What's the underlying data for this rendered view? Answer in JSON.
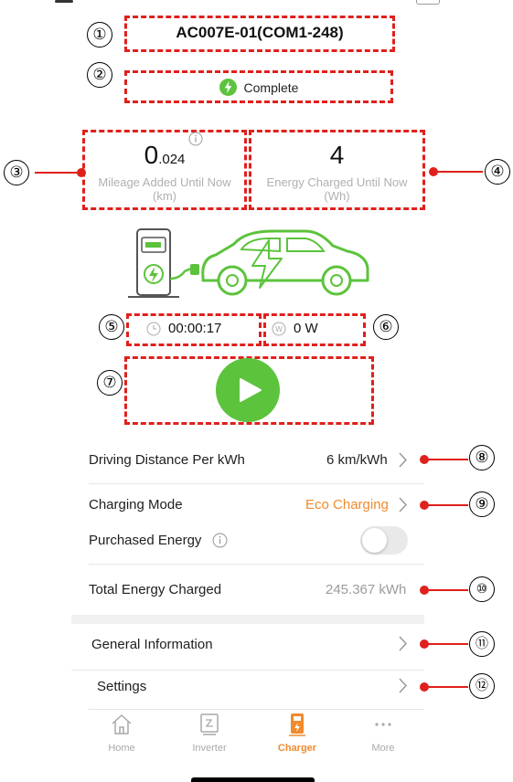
{
  "charger": {
    "name": "AC007E-01(COM1-248)",
    "status": "Complete",
    "mileage": {
      "value_main": "0",
      "value_sub": ".024",
      "label": "Mileage Added Until Now",
      "unit": "(km)"
    },
    "energy": {
      "value": "4",
      "label": "Energy Charged Until Now",
      "unit": "(Wh)"
    },
    "elapsed_time": "00:00:17",
    "power": "0 W"
  },
  "settings": {
    "driving_distance": {
      "label": "Driving Distance Per kWh",
      "value": "6 km/kWh"
    },
    "charging_mode": {
      "label": "Charging Mode",
      "value": "Eco Charging"
    },
    "purchased_energy": {
      "label": "Purchased Energy",
      "enabled": false
    },
    "total_energy": {
      "label": "Total Energy Charged",
      "value": "245.367 kWh"
    },
    "general_information": {
      "label": "General Information"
    },
    "settings_item": {
      "label": "Settings"
    }
  },
  "callouts": [
    "①",
    "②",
    "③",
    "④",
    "⑤",
    "⑥",
    "⑦",
    "⑧",
    "⑨",
    "⑩",
    "⑪",
    "⑫"
  ],
  "tabs": [
    {
      "label": "Home",
      "icon": "home-icon",
      "active": false
    },
    {
      "label": "Inverter",
      "icon": "inverter-icon",
      "active": false
    },
    {
      "label": "Charger",
      "icon": "charger-icon",
      "active": true
    },
    {
      "label": "More",
      "icon": "more-icon",
      "active": false
    }
  ],
  "colors": {
    "accent_orange": "#f08a2c",
    "green": "#5cc33c",
    "annotation_red": "#e0201c"
  }
}
